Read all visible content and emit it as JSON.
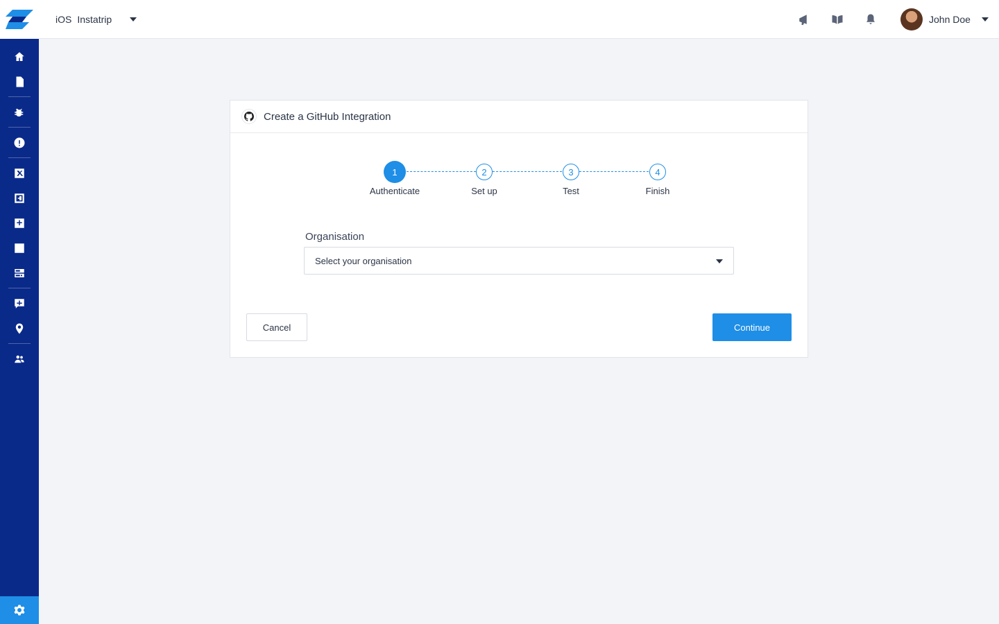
{
  "topbar": {
    "platform": "iOS",
    "app_name": "Instatrip",
    "icons": [
      "megaphone-icon",
      "book-icon",
      "bell-icon"
    ],
    "user": {
      "name": "John Doe"
    }
  },
  "sidebar": {
    "items": [
      "home-icon",
      "document-icon",
      "bug-icon",
      "alert-icon",
      "crash-icon",
      "feedback-icon",
      "apm-icon",
      "network-icon",
      "sessions-icon",
      "survey-icon",
      "location-icon",
      "team-icon"
    ],
    "settings": "gear-icon"
  },
  "card": {
    "title": "Create a GitHub Integration",
    "steps": [
      {
        "number": "1",
        "label": "Authenticate",
        "active": true
      },
      {
        "number": "2",
        "label": "Set up",
        "active": false
      },
      {
        "number": "3",
        "label": "Test",
        "active": false
      },
      {
        "number": "4",
        "label": "Finish",
        "active": false
      }
    ],
    "organisation": {
      "label": "Organisation",
      "placeholder": "Select your organisation"
    },
    "cancel_label": "Cancel",
    "continue_label": "Continue"
  },
  "colors": {
    "sidebar": "#0a2a8a",
    "accent": "#1e8ee6",
    "background": "#f3f4f8"
  }
}
